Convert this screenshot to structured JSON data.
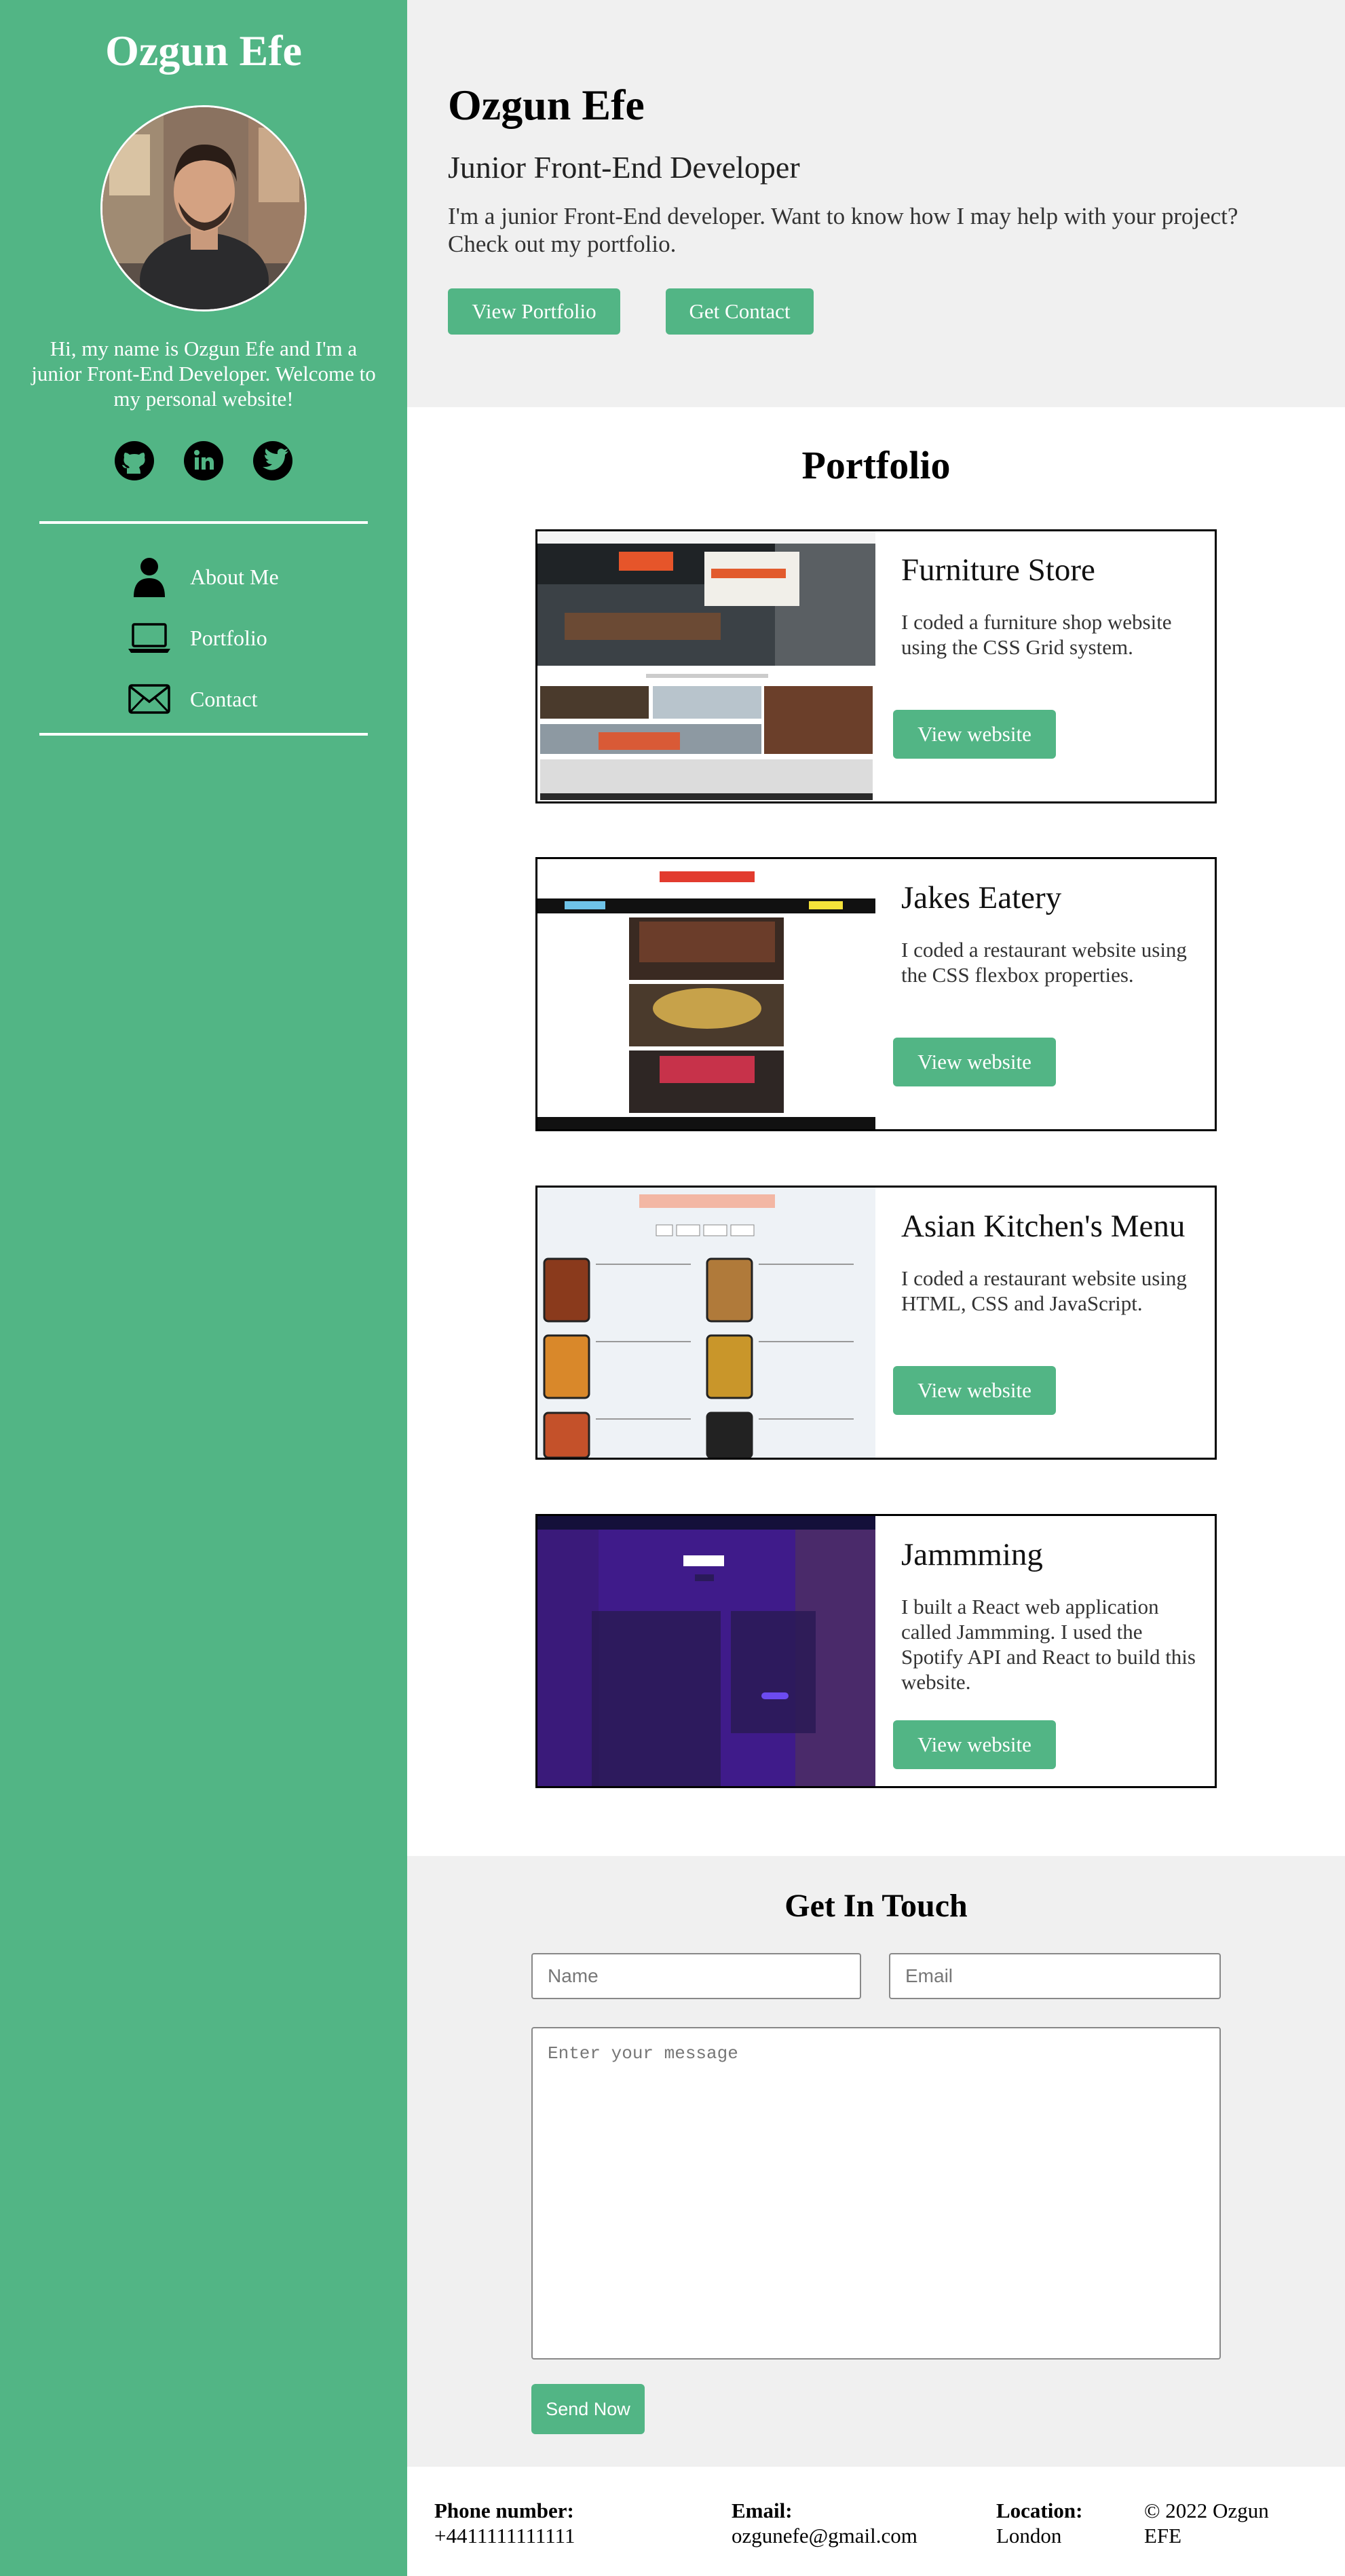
{
  "sidebar": {
    "title": "Ozgun Efe",
    "intro": "Hi, my name is Ozgun Efe and I'm a junior Front-End Developer. Welcome to my personal website!",
    "socials": [
      {
        "icon": "github-icon"
      },
      {
        "icon": "linkedin-icon"
      },
      {
        "icon": "twitter-icon"
      }
    ],
    "nav": [
      {
        "label": "About Me",
        "icon": "person-icon"
      },
      {
        "label": "Portfolio",
        "icon": "laptop-icon"
      },
      {
        "label": "Contact",
        "icon": "envelope-icon"
      }
    ]
  },
  "hero": {
    "name": "Ozgun Efe",
    "role": "Junior Front-End Developer",
    "description": "I'm a junior Front-End developer. Want to know how I may help with your project? Check out my portfolio.",
    "portfolio_button": "View Portfolio",
    "contact_button": "Get Contact"
  },
  "portfolio": {
    "title": "Portfolio",
    "projects": [
      {
        "title": "Furniture Store",
        "description": "I coded a furniture shop website using the CSS Grid system.",
        "button": "View website"
      },
      {
        "title": "Jakes Eatery",
        "description": "I coded a restaurant website using the CSS flexbox properties.",
        "button": "View website"
      },
      {
        "title": "Asian Kitchen's Menu",
        "description": "I coded a restaurant website using HTML, CSS and JavaScript.",
        "button": "View website"
      },
      {
        "title": "Jammming",
        "description": "I built a React web application called Jammming. I used the Spotify API and React to build this website.",
        "button": "View website"
      }
    ]
  },
  "contact": {
    "title": "Get In Touch",
    "name_placeholder": "Name",
    "email_placeholder": "Email",
    "message_placeholder": "Enter your message",
    "send_button": "Send Now"
  },
  "footer": {
    "phone_label": "Phone number:",
    "phone": "+4411111111111",
    "email_label": "Email:",
    "email": "ozgunefe@gmail.com",
    "location_label": "Location:",
    "location": "London",
    "copyright": "© 2022 Ozgun EFE"
  },
  "colors": {
    "accent": "#52b585",
    "hero_bg": "#f0f0f0"
  }
}
